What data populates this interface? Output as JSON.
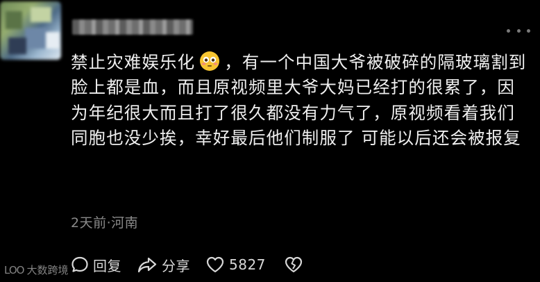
{
  "comment": {
    "text_before_emoji": "禁止灾难娱乐化",
    "text_after_emoji": "，有一个中国大爷被破碎的隔玻璃割到脸上都是血，而且原视频里大爷大妈已经打的很累了，因为年纪很大而且打了很久都没有力气了，原视频看着我们同胞也没少挨，幸好最后他们制服了  可能以后还会被报复",
    "time": "2天前",
    "location": "河南",
    "separator": "·"
  },
  "actions": {
    "reply_label": "回复",
    "share_label": "分享",
    "like_count": "5827"
  },
  "watermark": {
    "logo_text": "LOO",
    "text": "大数跨境"
  },
  "icons": {
    "emoji": "flushed-face-emoji",
    "reply": "speech-bubble-icon",
    "share": "share-arrow-icon",
    "like": "heart-icon",
    "dislike": "broken-heart-icon",
    "more": "more-dots-icon"
  },
  "colors": {
    "background": "#000000",
    "text": "#efefef",
    "meta": "#8a8a8a",
    "emoji": "#f7c531"
  }
}
